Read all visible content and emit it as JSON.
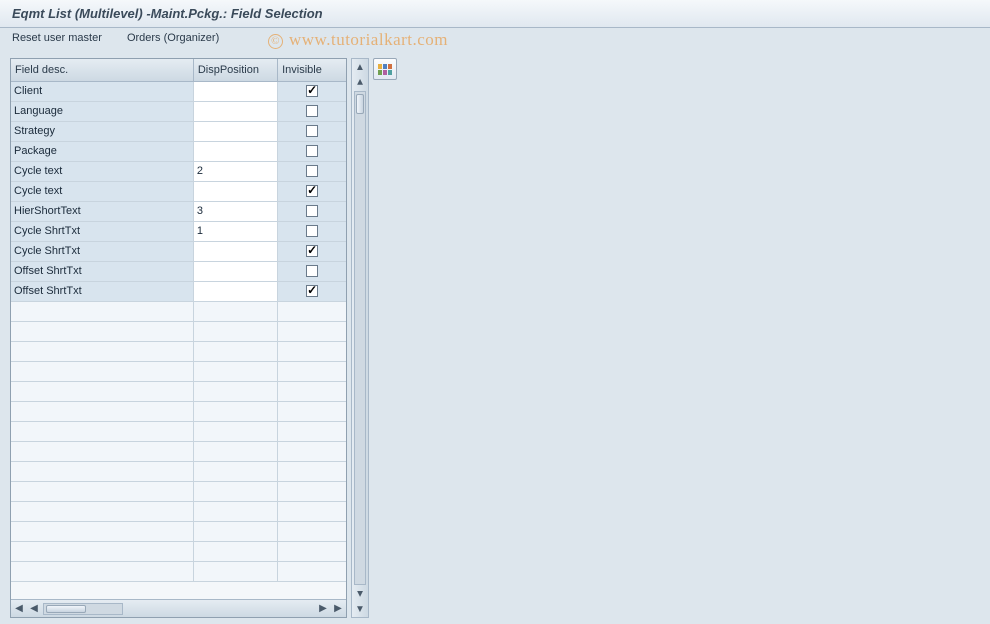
{
  "title": "Eqmt List (Multilevel) -Maint.Pckg.: Field Selection",
  "toolbar": {
    "reset_label": "Reset user master",
    "orders_label": "Orders (Organizer)"
  },
  "watermark": {
    "symbol": "©",
    "text": "www.tutorialkart.com"
  },
  "columns": {
    "desc": "Field desc.",
    "pos": "DispPosition",
    "inv": "Invisible"
  },
  "rows": [
    {
      "desc": "Client",
      "pos": "",
      "inv": true
    },
    {
      "desc": "Language",
      "pos": "",
      "inv": false
    },
    {
      "desc": "Strategy",
      "pos": "",
      "inv": false
    },
    {
      "desc": "Package",
      "pos": "",
      "inv": false
    },
    {
      "desc": "Cycle text",
      "pos": "2",
      "inv": false
    },
    {
      "desc": "Cycle text",
      "pos": "",
      "inv": true
    },
    {
      "desc": "HierShortText",
      "pos": "3",
      "inv": false
    },
    {
      "desc": "Cycle ShrtTxt",
      "pos": "1",
      "inv": false
    },
    {
      "desc": "Cycle ShrtTxt",
      "pos": "",
      "inv": true
    },
    {
      "desc": "Offset ShrtTxt",
      "pos": "",
      "inv": false
    },
    {
      "desc": "Offset ShrtTxt",
      "pos": "",
      "inv": true
    }
  ],
  "empty_rows": 14,
  "icons": {
    "settings_name": "table-settings-icon"
  },
  "scroll_arrows": {
    "left": "◀",
    "right": "▶",
    "up": "▲",
    "down": "▼"
  }
}
